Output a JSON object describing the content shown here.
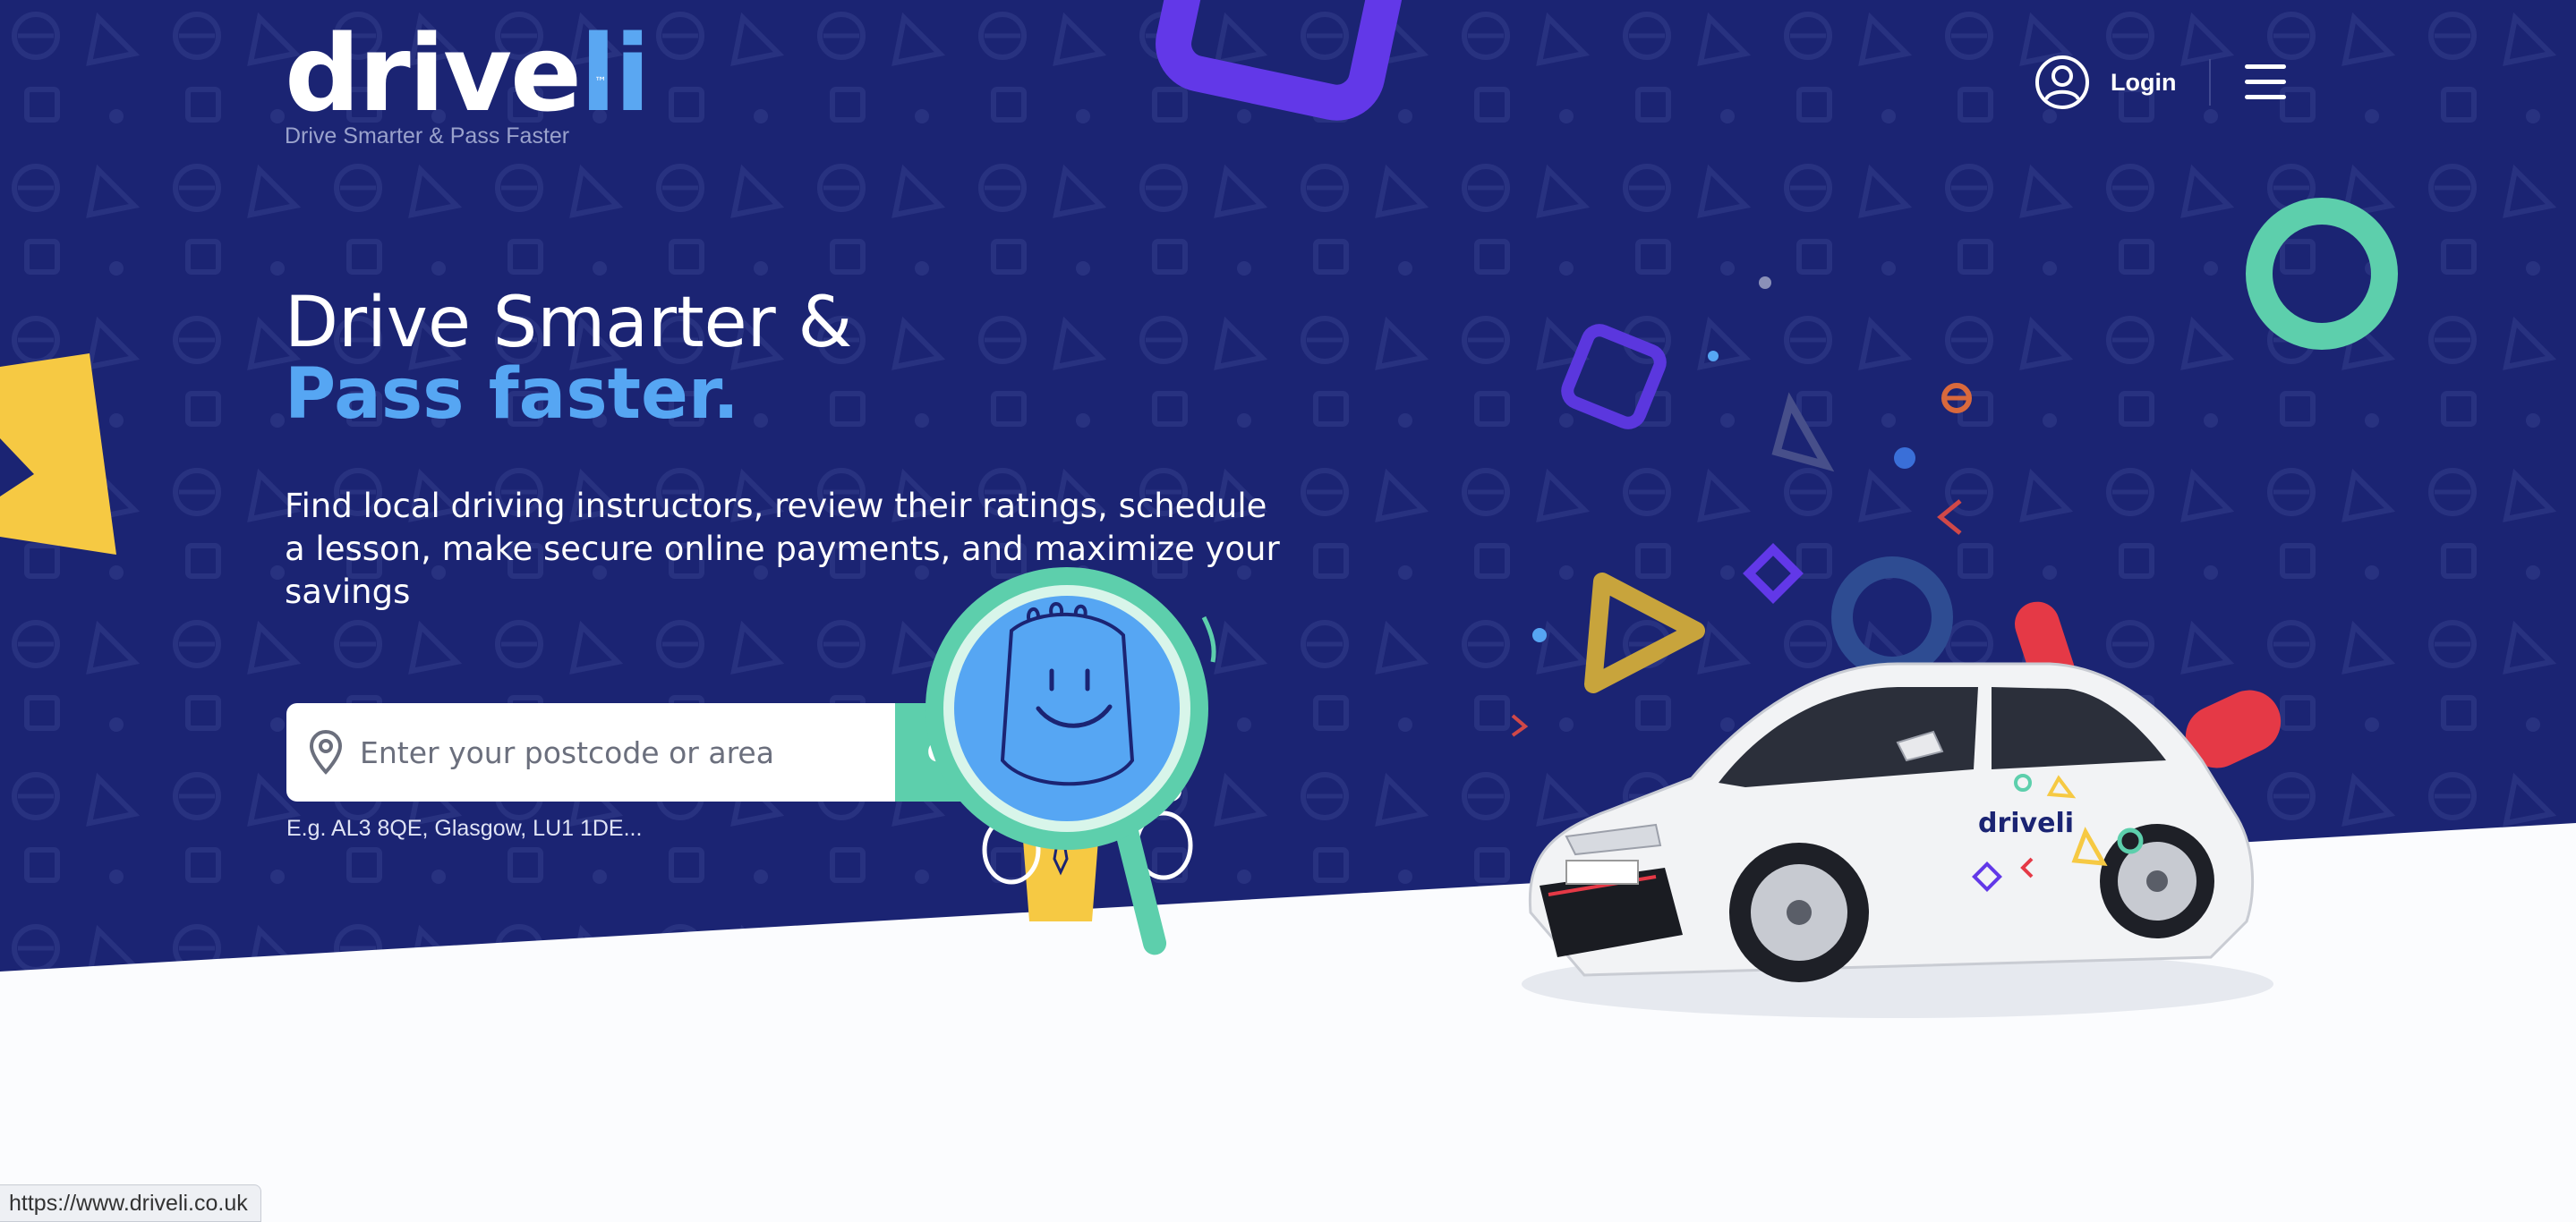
{
  "header": {
    "logo_text_main": "drive",
    "logo_text_accent": "li",
    "logo_trademark": "™",
    "tagline": "Drive Smarter & Pass Faster",
    "login_label": "Login",
    "login_icon": "user-circle-icon",
    "menu_icon": "hamburger-menu-icon"
  },
  "hero": {
    "headline_line1": "Drive Smarter &",
    "headline_line2": "Pass faster.",
    "subtext": "Find local driving instructors, review their ratings, schedule a lesson, make secure online payments, and maximize your savings"
  },
  "search": {
    "placeholder": "Enter your postcode or area",
    "value": "",
    "go_label": "GO",
    "example_text": "E.g. AL3 8QE, Glasgow, LU1 1DE...",
    "icon": "location-pin-icon"
  },
  "car": {
    "decal_text": "driveli"
  },
  "status_bar": {
    "url": "https://www.driveli.co.uk"
  },
  "colors": {
    "background_navy": "#1b2473",
    "accent_blue": "#56a6f3",
    "go_green": "#5dcfac",
    "shape_yellow": "#f6c943",
    "shape_purple": "#6238e8",
    "shape_teal": "#5dcfac",
    "shape_red": "#e53946"
  }
}
